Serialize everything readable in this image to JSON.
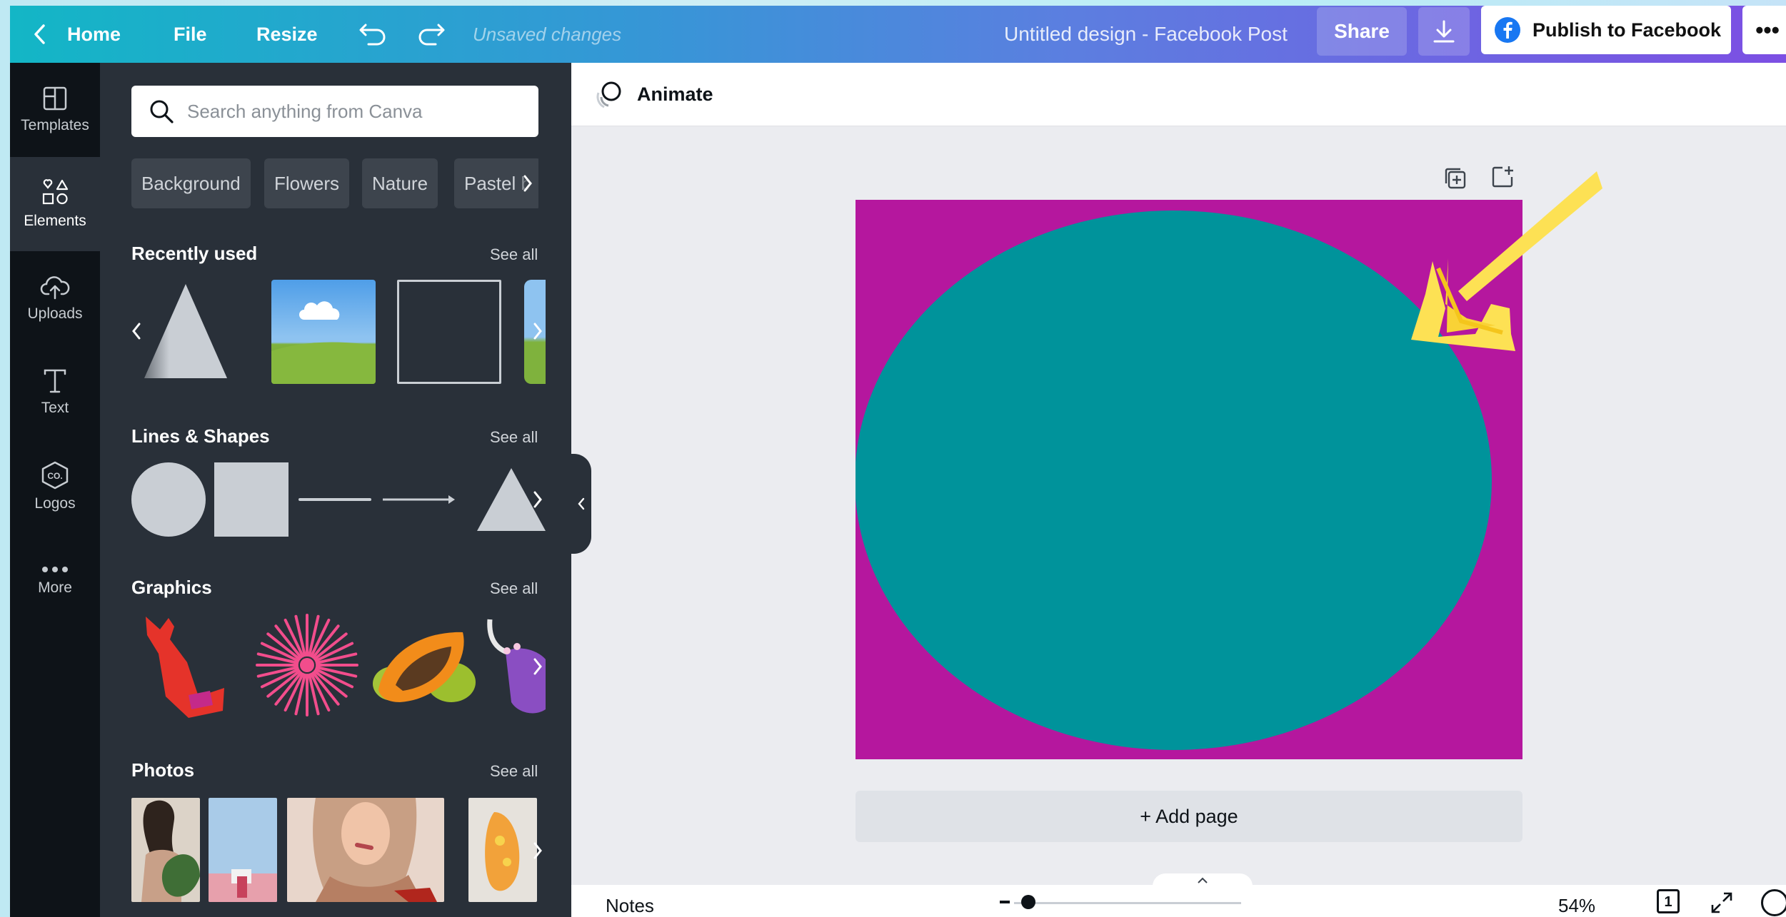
{
  "topbar": {
    "home_label": "Home",
    "file_label": "File",
    "resize_label": "Resize",
    "unsaved_label": "Unsaved changes",
    "title": "Untitled design - Facebook Post",
    "share_label": "Share",
    "publish_label": "Publish to Facebook",
    "more_label": "•••",
    "colors": {
      "gradient_start": "#13b6c6",
      "gradient_end": "#7c4fe3"
    }
  },
  "rail": {
    "items": [
      {
        "label": "Templates",
        "icon": "templates-icon"
      },
      {
        "label": "Elements",
        "icon": "elements-icon",
        "active": true
      },
      {
        "label": "Uploads",
        "icon": "uploads-icon"
      },
      {
        "label": "Text",
        "icon": "text-icon"
      },
      {
        "label": "Logos",
        "icon": "logos-icon"
      },
      {
        "label": "More",
        "icon": "more-icon"
      }
    ]
  },
  "panel": {
    "search_placeholder": "Search anything from Canva",
    "chips": [
      "Background",
      "Flowers",
      "Nature",
      "Pastel b"
    ],
    "sections": {
      "recent": {
        "title": "Recently used",
        "see_all": "See all"
      },
      "shapes": {
        "title": "Lines & Shapes",
        "see_all": "See all"
      },
      "graphics": {
        "title": "Graphics",
        "see_all": "See all"
      },
      "photos": {
        "title": "Photos",
        "see_all": "See all"
      }
    },
    "logos_badge": "CO."
  },
  "canvas": {
    "animate_label": "Animate",
    "add_page_label": "+ Add page",
    "background_color": "#b5179e",
    "circle_color": "#00939b",
    "arrow_color": "#fde154"
  },
  "bottombar": {
    "notes_label": "Notes",
    "zoom_value": "54%",
    "page_count": "1"
  }
}
